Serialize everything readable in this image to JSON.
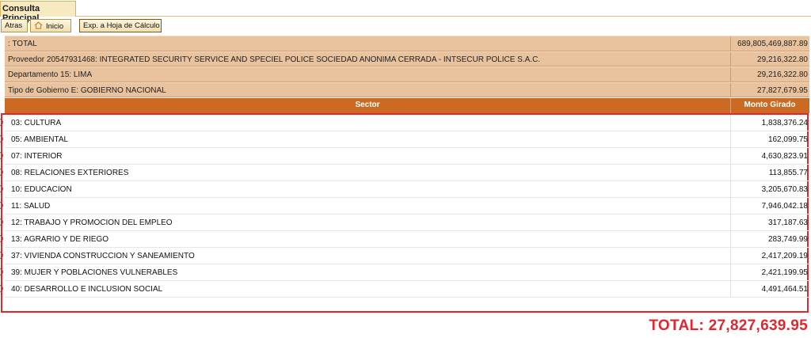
{
  "tab": {
    "label": "Consulta Principal"
  },
  "toolbar": {
    "back_label": "Atras",
    "home_label": "Inicio",
    "export_label": "Exp. a Hoja de Cálculo"
  },
  "summary": [
    {
      "label": ": TOTAL",
      "value": "689,805,469,887.89"
    },
    {
      "label": "Proveedor 20547931468: INTEGRATED SECURITY SERVICE AND SPECIEL POLICE SOCIEDAD ANONIMA CERRADA - INTSECUR POLICE S.A.C.",
      "value": "29,216,322.80"
    },
    {
      "label": "Departamento 15: LIMA",
      "value": "29,216,322.80"
    },
    {
      "label": "Tipo de Gobierno E: GOBIERNO NACIONAL",
      "value": "27,827,679.95"
    }
  ],
  "columns": {
    "sector": "Sector",
    "monto": "Monto Girado"
  },
  "rows": [
    {
      "sector": "03: CULTURA",
      "monto": "1,838,376.24"
    },
    {
      "sector": "05: AMBIENTAL",
      "monto": "162,099.75"
    },
    {
      "sector": "07: INTERIOR",
      "monto": "4,630,823.91"
    },
    {
      "sector": "08: RELACIONES EXTERIORES",
      "monto": "113,855.77"
    },
    {
      "sector": "10: EDUCACION",
      "monto": "3,205,670.83"
    },
    {
      "sector": "11: SALUD",
      "monto": "7,946,042.18"
    },
    {
      "sector": "12: TRABAJO Y PROMOCION DEL EMPLEO",
      "monto": "317,187.63"
    },
    {
      "sector": "13: AGRARIO Y DE RIEGO",
      "monto": "283,749.99"
    },
    {
      "sector": "37: VIVIENDA CONSTRUCCION Y SANEAMIENTO",
      "monto": "2,417,209.19"
    },
    {
      "sector": "39: MUJER Y POBLACIONES VULNERABLES",
      "monto": "2,421,199.95"
    },
    {
      "sector": "40: DESARROLLO E INCLUSION SOCIAL",
      "monto": "4,491,464.51"
    }
  ],
  "total_annotation": "TOTAL: 27,827,639.95",
  "icons": {
    "home": "home-icon"
  },
  "colors": {
    "header": "#cc6a24",
    "summary": "#e8c39e",
    "highlight": "#e3262e"
  }
}
